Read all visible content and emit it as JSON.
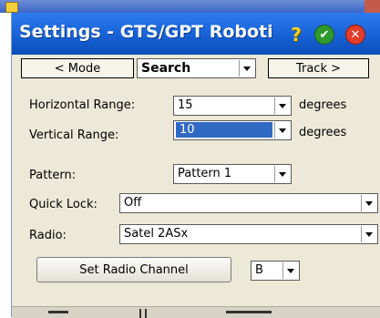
{
  "dialog": {
    "title": "Settings - GTS/GPT Roboti",
    "help_icon_glyph": "?",
    "ok_icon_glyph": "✔",
    "close_icon_glyph": "✕"
  },
  "nav": {
    "mode_button_label": "< Mode",
    "mode_select_value": "Search",
    "track_button_label": "Track >"
  },
  "form": {
    "horizontal_range_label": "Horizontal Range:",
    "horizontal_range_value": "15",
    "horizontal_units": "degrees",
    "vertical_range_label": "Vertical Range:",
    "vertical_range_value": "10",
    "vertical_units": "degrees",
    "pattern_label": "Pattern:",
    "pattern_value": "Pattern 1",
    "quick_lock_label": "Quick Lock:",
    "quick_lock_value": "Off",
    "radio_label": "Radio:",
    "radio_value": "Satel 2ASx",
    "set_radio_channel_label": "Set Radio Channel",
    "radio_channel_value": "B"
  },
  "colors": {
    "titlebar": "#1661d6",
    "dialog_bg": "#ece9d8",
    "selection": "#316ac5"
  }
}
